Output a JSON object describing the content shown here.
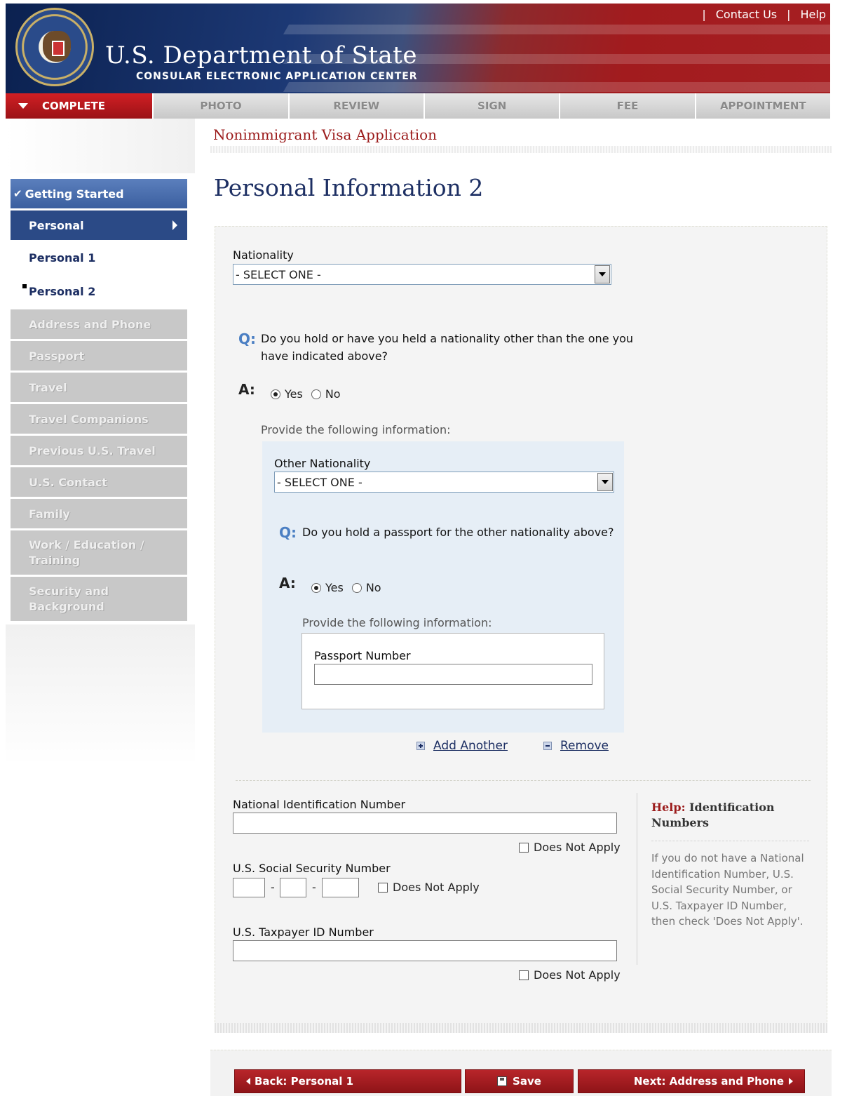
{
  "header": {
    "contact_label": "Contact Us",
    "help_label": "Help",
    "title": "U.S. Department of State",
    "subtitle": "CONSULAR ELECTRONIC APPLICATION CENTER",
    "seal_icon": "department-of-state-seal"
  },
  "tabs": [
    {
      "label": "COMPLETE",
      "active": true
    },
    {
      "label": "PHOTO"
    },
    {
      "label": "REVIEW"
    },
    {
      "label": "SIGN"
    },
    {
      "label": "FEE"
    },
    {
      "label": "APPOINTMENT"
    }
  ],
  "sidebar": {
    "items": [
      {
        "label": "Getting Started",
        "state": "completed"
      },
      {
        "label": "Personal",
        "state": "active"
      },
      {
        "label": "Personal 1",
        "state": "sub"
      },
      {
        "label": "Personal 2",
        "state": "current"
      },
      {
        "label": "Address and Phone",
        "state": "disabled"
      },
      {
        "label": "Passport",
        "state": "disabled"
      },
      {
        "label": "Travel",
        "state": "disabled"
      },
      {
        "label": "Travel Companions",
        "state": "disabled"
      },
      {
        "label": "Previous U.S. Travel",
        "state": "disabled"
      },
      {
        "label": "U.S. Contact",
        "state": "disabled"
      },
      {
        "label": "Family",
        "state": "disabled"
      },
      {
        "label": "Work / Education / Training",
        "state": "disabled"
      },
      {
        "label": "Security and Background",
        "state": "disabled"
      }
    ]
  },
  "main": {
    "app_title": "Nonimmigrant Visa Application",
    "page_title": "Personal Information 2",
    "nationality": {
      "label": "Nationality",
      "value": "- SELECT ONE -"
    },
    "q_mark": "Q:",
    "a_mark": "A:",
    "q1": {
      "text": "Do you hold or have you held a nationality other than the one you have indicated above?",
      "yes": "Yes",
      "no": "No",
      "selected": "Yes"
    },
    "provide_info": "Provide the following information:",
    "other_nationality": {
      "label": "Other Nationality",
      "value": "- SELECT ONE -"
    },
    "q2": {
      "text": "Do you hold a passport for the other nationality above?",
      "yes": "Yes",
      "no": "No",
      "selected": "Yes"
    },
    "passport_number": {
      "label": "Passport Number",
      "value": ""
    },
    "add_another": "Add Another",
    "remove": "Remove",
    "national_id": {
      "label": "National Identification Number",
      "value": ""
    },
    "ssn": {
      "label": "U.S. Social Security Number",
      "separator": "-"
    },
    "taxpayer": {
      "label": "U.S. Taxpayer ID Number",
      "value": ""
    },
    "does_not_apply": "Does Not Apply"
  },
  "help": {
    "title_strong": "Help:",
    "title_rest": "Identification Numbers",
    "body": "If you do not have a National Identification Number, U.S. Social Security Number, or U.S. Taxpayer ID Number, then check 'Does Not Apply'."
  },
  "footer": {
    "back_label": "Back: Personal 1",
    "save_label": "Save",
    "next_label": "Next: Address and Phone"
  },
  "colors": {
    "brand_red": "#a21b1e",
    "brand_navy": "#1d2f63",
    "accent_blue": "#4b7fc3"
  }
}
